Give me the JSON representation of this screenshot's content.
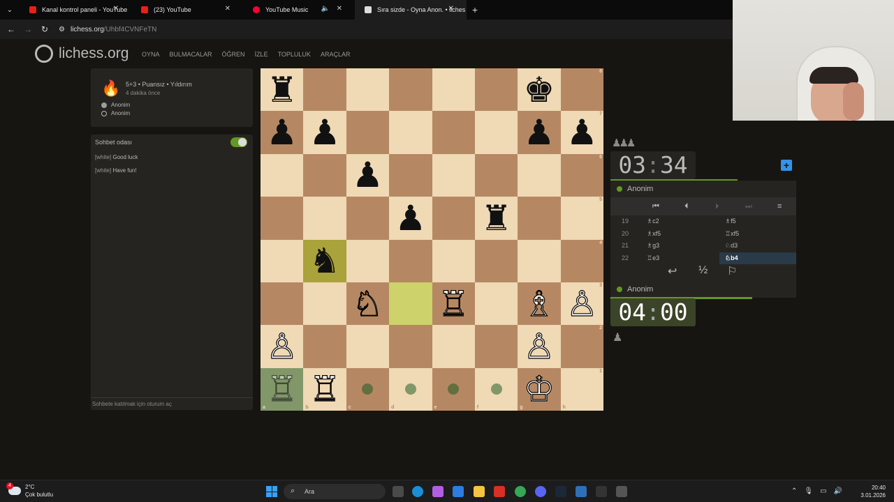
{
  "browser": {
    "tabs": [
      {
        "title": "Kanal kontrol paneli - YouTube",
        "icon": "youtube-icon"
      },
      {
        "title": "(23) YouTube",
        "icon": "youtube-icon"
      },
      {
        "title": "YouTube Music",
        "icon": "youtube-music-icon"
      },
      {
        "title": "Sıra sizde - Oyna Anon. • liches",
        "icon": "lichess-icon"
      }
    ],
    "url_host": "lichess.org",
    "url_path": "/Uhbf4CVNFeTN"
  },
  "site": {
    "logo_text": "lichess.org",
    "menu": [
      "OYNA",
      "BULMACALAR",
      "ÖĞREN",
      "İZLE",
      "TOPLULUK",
      "ARAÇLAR"
    ]
  },
  "game": {
    "title": "5+3 • Puansız • Yıldırım",
    "time_ago": "4 dakika önce",
    "players": [
      "Anonim",
      "Anonim"
    ]
  },
  "chat": {
    "title": "Sohbet odası",
    "lines": [
      {
        "who": "[white]",
        "text": "Good luck"
      },
      {
        "who": "[white]",
        "text": "Have fun!"
      }
    ],
    "input_placeholder": "Sohbete katılmak için oturum aç"
  },
  "board": {
    "files": [
      "a",
      "b",
      "c",
      "d",
      "e",
      "f",
      "g",
      "h"
    ],
    "ranks": [
      "8",
      "7",
      "6",
      "5",
      "4",
      "3",
      "2",
      "1"
    ],
    "pieces": {
      "a8": "♜",
      "g8": "♚",
      "a7": "♟",
      "b7": "♟",
      "g7": "♟",
      "h7": "♟",
      "c6": "♟",
      "d5": "♟",
      "f5": "♜",
      "b4": "♞",
      "c3": "♘",
      "e3": "♖",
      "g3": "♗",
      "h3": "♙",
      "a2": "♙",
      "g2": "♙",
      "a1": "♖",
      "b1": "♖",
      "g1": "♔"
    }
  },
  "clocks": {
    "opponent": {
      "min": "03",
      "sec": "34",
      "name": "Anonim"
    },
    "player": {
      "min": "04",
      "sec": "00",
      "name": "Anonim"
    }
  },
  "moves": [
    {
      "no": "19",
      "white": "♗c2",
      "black": "♗f5"
    },
    {
      "no": "20",
      "white": "♗xf5",
      "black": "♖xf5"
    },
    {
      "no": "21",
      "white": "♗g3",
      "black": "♘d3"
    },
    {
      "no": "22",
      "white": "♖e3",
      "black": "♘b4"
    }
  ],
  "taskbar": {
    "weather_temp": "2°C",
    "weather_desc": "Çok bulutlu",
    "weather_badge": "4",
    "search_placeholder": "Ara",
    "time": "20:40",
    "date": "3.01.2026"
  }
}
